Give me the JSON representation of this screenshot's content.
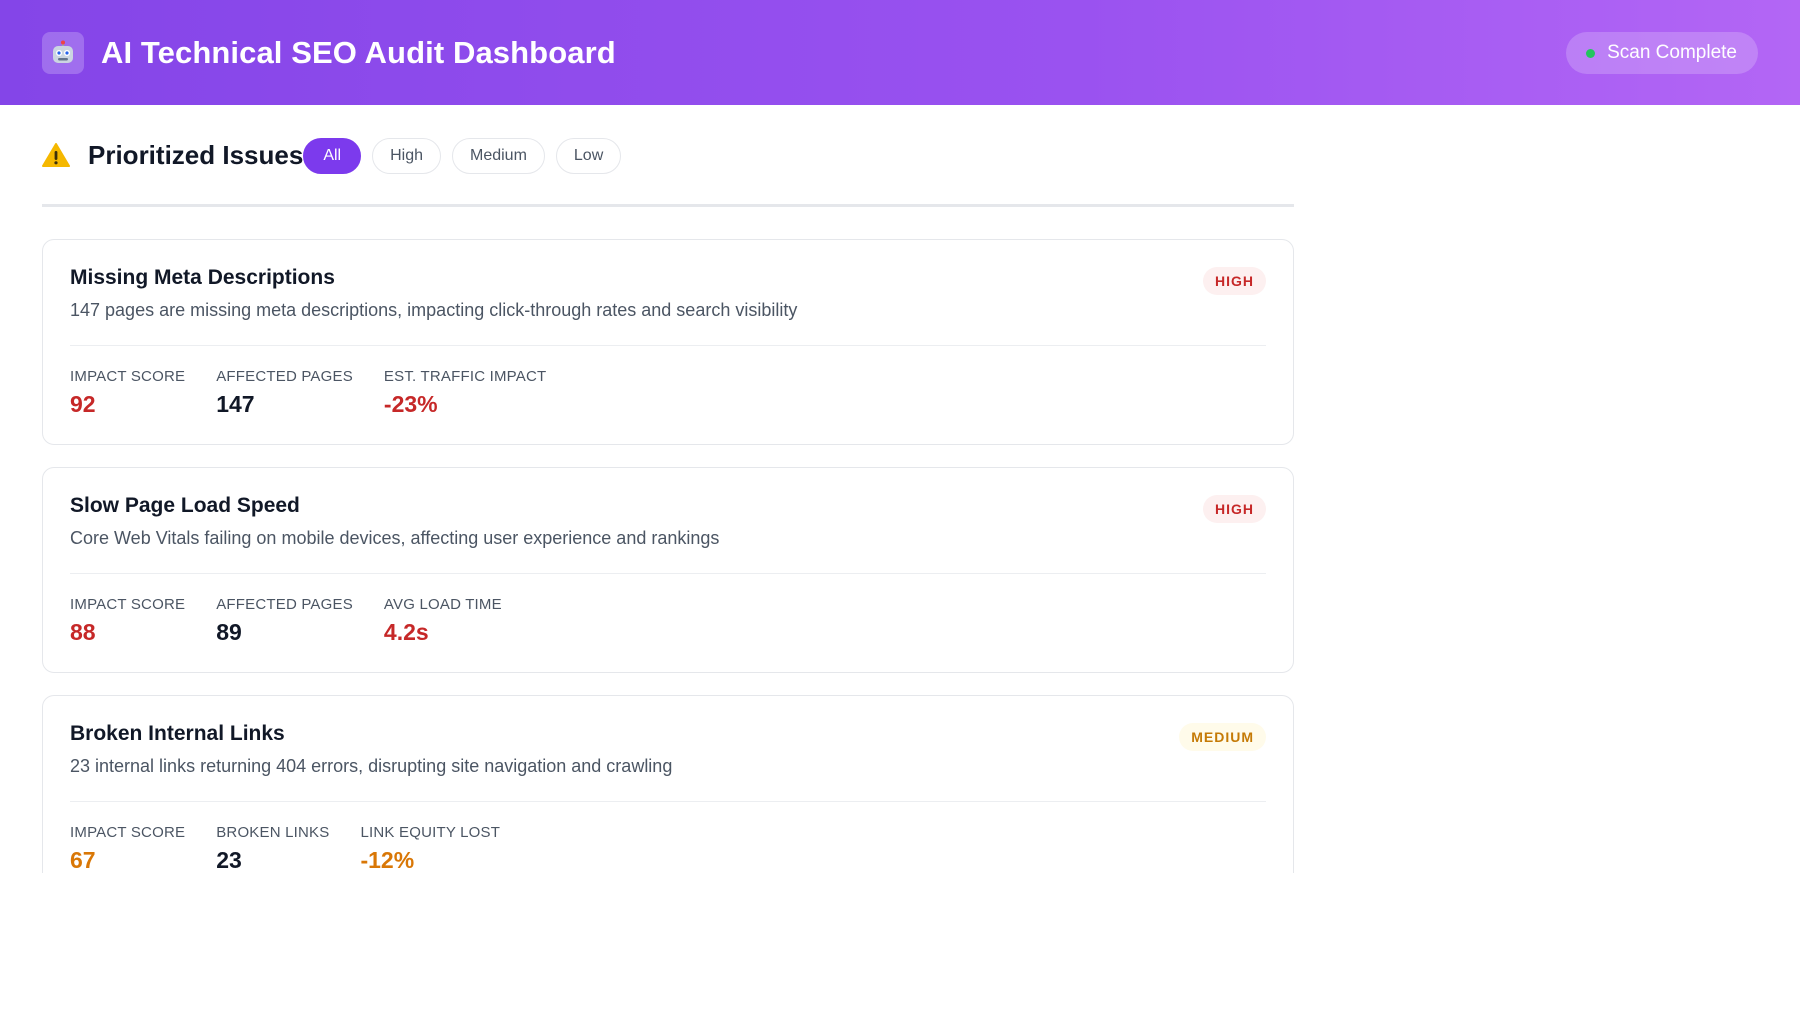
{
  "header": {
    "title": "AI Technical SEO Audit Dashboard",
    "app_icon": "robot-icon",
    "status": "Scan Complete",
    "status_color": "#22c55e"
  },
  "issues_section": {
    "icon": "warning-icon",
    "title": "Prioritized Issues",
    "filters": [
      "All",
      "High",
      "Medium",
      "Low"
    ],
    "active_filter": "All"
  },
  "issues": [
    {
      "title": "Missing Meta Descriptions",
      "description": "147 pages are missing meta descriptions, impacting click-through rates and search visibility",
      "severity": "HIGH",
      "metrics": [
        {
          "label": "IMPACT SCORE",
          "value": "92"
        },
        {
          "label": "AFFECTED PAGES",
          "value": "147"
        },
        {
          "label": "EST. TRAFFIC IMPACT",
          "value": "-23%"
        }
      ]
    },
    {
      "title": "Slow Page Load Speed",
      "description": "Core Web Vitals failing on mobile devices, affecting user experience and rankings",
      "severity": "HIGH",
      "metrics": [
        {
          "label": "IMPACT SCORE",
          "value": "88"
        },
        {
          "label": "AFFECTED PAGES",
          "value": "89"
        },
        {
          "label": "AVG LOAD TIME",
          "value": "4.2s"
        }
      ]
    },
    {
      "title": "Broken Internal Links",
      "description": "23 internal links returning 404 errors, disrupting site navigation and crawling",
      "severity": "MEDIUM",
      "metrics": [
        {
          "label": "IMPACT SCORE",
          "value": "67"
        },
        {
          "label": "BROKEN LINKS",
          "value": "23"
        },
        {
          "label": "LINK EQUITY LOST",
          "value": "-12%"
        }
      ]
    }
  ],
  "colors": {
    "accent": "#7c3aed",
    "high": "#c62828",
    "medium": "#d97706"
  }
}
